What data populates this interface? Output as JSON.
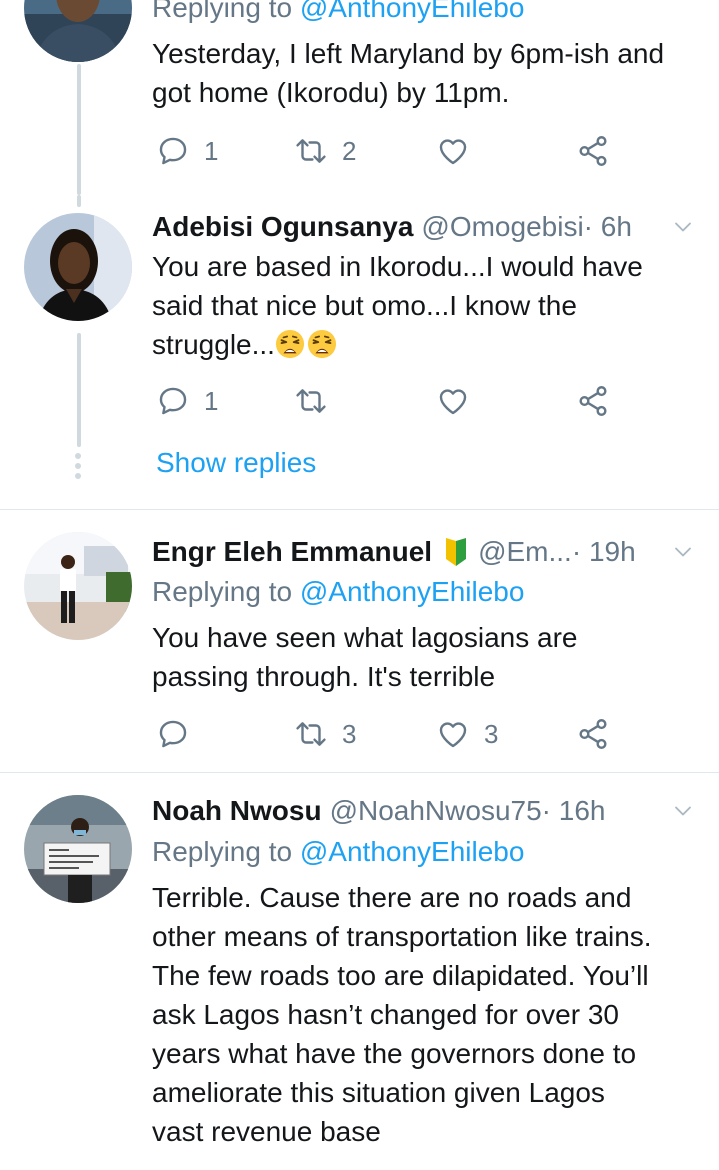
{
  "colors": {
    "accent": "#1da1f2",
    "muted": "#657786",
    "divider": "#e1e8ed",
    "text": "#14171a"
  },
  "tweets": [
    {
      "replying_prefix": "Replying to ",
      "replying_to": "@AnthonyEhilebo",
      "body_lines": [
        "Yesterday, I left Maryland by 6pm-ish and",
        "got home (Ikorodu) by 11pm."
      ],
      "actions": {
        "replies": "1",
        "retweets": "2",
        "likes": ""
      }
    },
    {
      "name": "Adebisi Ogunsanya",
      "handle": "@Omogebisi",
      "time": " · 6h",
      "body_lines": [
        "You are based in Ikorodu...I would have",
        "said that nice but omo...I know the",
        "struggle..."
      ],
      "emojis": [
        "weary-face",
        "weary-face"
      ],
      "actions": {
        "replies": "1",
        "retweets": "",
        "likes": ""
      },
      "show_replies": "Show replies"
    },
    {
      "name": "Engr Eleh Emmanuel",
      "badge": "japanese-beginner-symbol",
      "handle": "@Em...",
      "time": " · 19h",
      "replying_prefix": "Replying to ",
      "replying_to": "@AnthonyEhilebo",
      "body_lines": [
        "You have seen what lagosians are",
        "passing through. It's terrible"
      ],
      "actions": {
        "replies": "",
        "retweets": "3",
        "likes": "3"
      }
    },
    {
      "name": "Noah Nwosu",
      "handle": "@NoahNwosu75",
      "time": " · 16h",
      "replying_prefix": "Replying to ",
      "replying_to": "@AnthonyEhilebo",
      "body_lines": [
        "Terrible. Cause there are no roads and",
        "other means of transportation like trains.",
        "The few roads too are dilapidated. You’ll",
        "ask Lagos hasn’t changed for over 30",
        "years what have the governors done to",
        "ameliorate this situation given Lagos",
        "vast revenue base"
      ]
    }
  ]
}
